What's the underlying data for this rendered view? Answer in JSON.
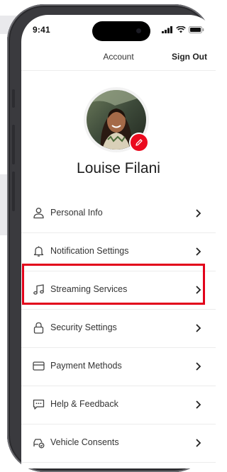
{
  "status_bar": {
    "time": "9:41"
  },
  "header": {
    "title": "Account",
    "sign_out_label": "Sign Out"
  },
  "profile": {
    "name": "Louise Filani"
  },
  "menu": {
    "items": [
      {
        "label": "Personal Info",
        "icon": "person-icon"
      },
      {
        "label": "Notification Settings",
        "icon": "bell-icon"
      },
      {
        "label": "Streaming Services",
        "icon": "music-note-icon",
        "highlighted": true
      },
      {
        "label": "Security Settings",
        "icon": "lock-icon"
      },
      {
        "label": "Payment Methods",
        "icon": "credit-card-icon"
      },
      {
        "label": "Help & Feedback",
        "icon": "chat-icon"
      },
      {
        "label": "Vehicle Consents",
        "icon": "car-shield-icon"
      }
    ]
  },
  "colors": {
    "accent": "#eb0a1e",
    "highlight_border": "#e2001a"
  }
}
